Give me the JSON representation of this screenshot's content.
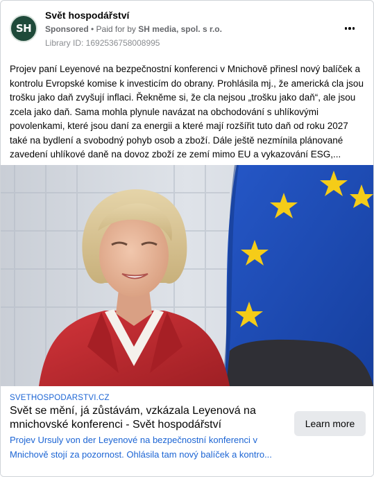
{
  "page": {
    "name": "Svět hospodářství",
    "avatar_initials": "SH",
    "sponsored_label": "Sponsored",
    "paid_for_prefix": "• Paid for by",
    "paid_for_name": "SH media, spol. s r.o.",
    "library_id": "Library ID: 1692536758008995"
  },
  "post": {
    "text": "Projev paní Leyenové na bezpečnostní konferenci v Mnichově přinesl nový balíček a kontrolu Evropské komise k investicím do obrany. Prohlásila mj., že americká cla jsou trošku jako daň zvyšují inflaci. Řekněme si, že cla nejsou „trošku jako daň“, ale jsou zcela jako daň. Sama mohla plynule navázat na obchodování s uhlíkovými povolenkami, které jsou daní za energii a které mají rozšířit tuto daň od roku 2027 také na bydlení a svobodný pohyb osob a zboží. Dále ještě nezmínila plánované zavedení uhlíkové daně na dovoz zboží ze zemí mimo EU a vykazování ESG,..."
  },
  "link": {
    "domain": "SVETHOSPODARSTVI.CZ",
    "title": "Svět se mění, já zůstávám, vzkázala Leyenová na mnichovské konferenci - Svět hospodářství",
    "description": "Projev Ursuly von der Leyenové na bezpečnostní konferenci v Mnichově stojí za pozornost. Ohlásila tam nový balíček a kontro...",
    "cta_label": "Learn more"
  },
  "colors": {
    "avatar_bg": "#1f4a3a",
    "link_blue": "#1b64d4",
    "eu_blue": "#1a49b8",
    "eu_star": "#f5cc18",
    "jacket_red": "#c2282c"
  },
  "icons": {
    "more": "three-dots-horizontal-icon"
  }
}
